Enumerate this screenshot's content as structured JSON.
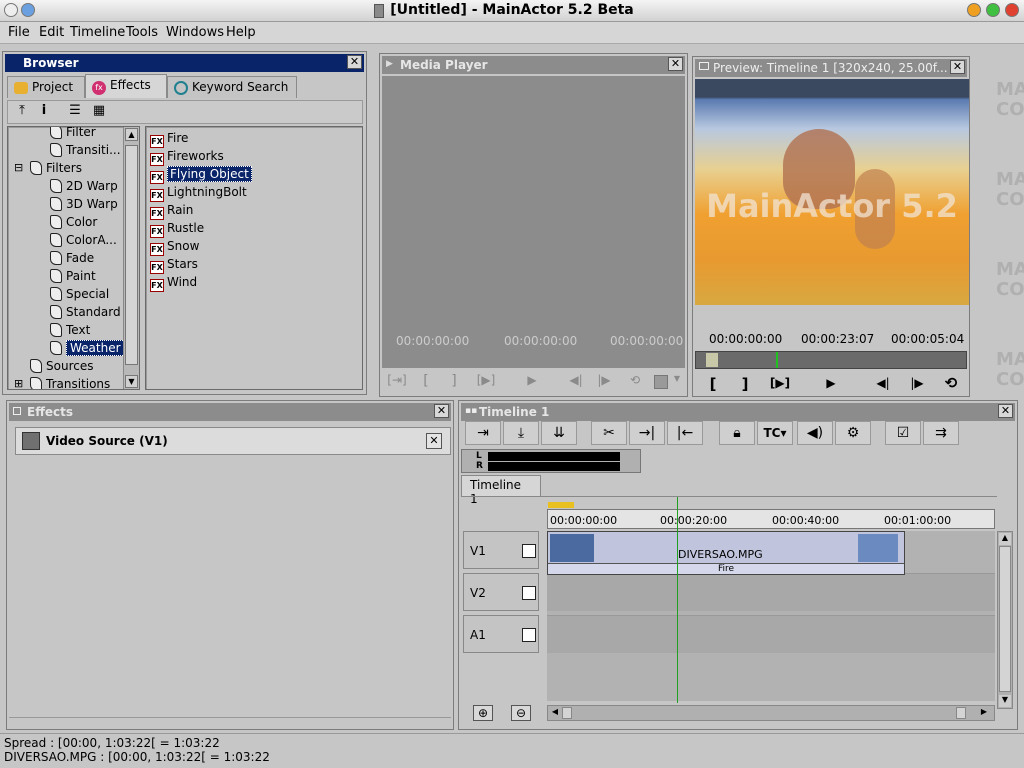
{
  "window": {
    "title": "[Untitled] - MainActor 5.2 Beta"
  },
  "menu": [
    "File",
    "Edit",
    "Timeline",
    "Tools",
    "Windows",
    "Help"
  ],
  "browser": {
    "title": "Browser",
    "tabs": [
      "Project",
      "Effects",
      "Keyword Search"
    ],
    "tree": [
      {
        "label": "Filter",
        "indent": 2
      },
      {
        "label": "Transiti...",
        "indent": 2
      },
      {
        "label": "Filters",
        "indent": 1,
        "expander": "⊟"
      },
      {
        "label": "2D Warp",
        "indent": 2
      },
      {
        "label": "3D Warp",
        "indent": 2
      },
      {
        "label": "Color",
        "indent": 2
      },
      {
        "label": "ColorA...",
        "indent": 2
      },
      {
        "label": "Fade",
        "indent": 2
      },
      {
        "label": "Paint",
        "indent": 2
      },
      {
        "label": "Special",
        "indent": 2
      },
      {
        "label": "Standard",
        "indent": 2
      },
      {
        "label": "Text",
        "indent": 2
      },
      {
        "label": "Weather",
        "indent": 2,
        "selected": true
      },
      {
        "label": "Sources",
        "indent": 1
      },
      {
        "label": "Transitions",
        "indent": 1,
        "expander": "⊞"
      }
    ],
    "effects": [
      "Fire",
      "Fireworks",
      "Flying Object",
      "LightningBolt",
      "Rain",
      "Rustle",
      "Snow",
      "Stars",
      "Wind"
    ],
    "selected_effect": "Flying Object"
  },
  "media_player": {
    "title": "Media Player",
    "timecodes": [
      "00:00:00:00",
      "00:00:00:00",
      "00:00:00:00"
    ]
  },
  "preview": {
    "title": "Preview:  Timeline 1  [320x240, 25.00f...",
    "watermark": "MainActor 5.2",
    "timecodes": [
      "00:00:00:00",
      "00:00:23:07",
      "00:00:05:04"
    ]
  },
  "effects_panel": {
    "title": "Effects",
    "item": "Video Source (V1)"
  },
  "timeline": {
    "title": "Timeline 1",
    "tab": "Timeline 1",
    "lr_labels": [
      "L",
      "R"
    ],
    "tc_button": "TC",
    "ruler": [
      "00:00:00:00",
      "00:00:20:00",
      "00:00:40:00",
      "00:01:00:00"
    ],
    "tracks": [
      "V1",
      "V2",
      "A1"
    ],
    "clip": {
      "name": "DIVERSAO.MPG",
      "effect": "Fire"
    }
  },
  "status": {
    "line1": "Spread : [00:00, 1:03:22[ = 1:03:22",
    "line2": "DIVERSAO.MPG : [00:00, 1:03:22[ = 1:03:22"
  },
  "bg_logo": "MAI CONC"
}
